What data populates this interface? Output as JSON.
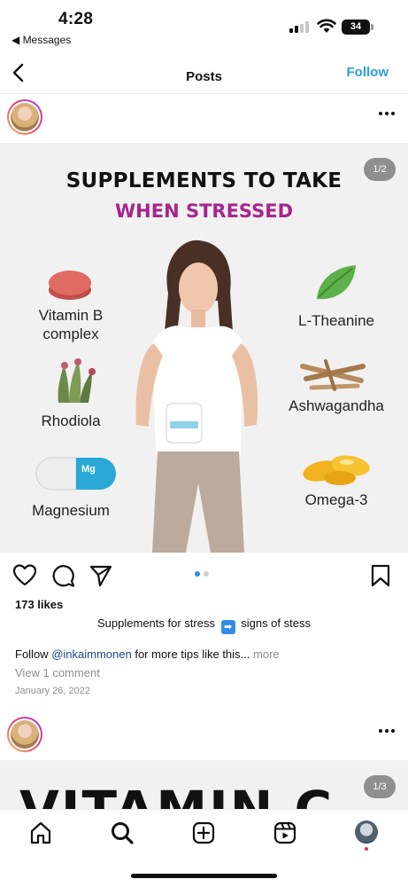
{
  "status_bar": {
    "time": "4:28",
    "back_app": "◀ Messages",
    "battery": "34"
  },
  "nav": {
    "title": "Posts",
    "follow_label": "Follow"
  },
  "post1": {
    "counter": "1/2",
    "image": {
      "title": "SUPPLEMENTS TO TAKE",
      "subtitle": "WHEN STRESSED",
      "items": [
        "Vitamin B complex",
        "Rhodiola",
        "Magnesium",
        "L-Theanine",
        "Ashwagandha",
        "Omega-3"
      ],
      "capsule_text": "Mg"
    },
    "likes": "173 likes",
    "caption_left": "Supplements for stress",
    "caption_right": "signs of stess",
    "caption_arrow": "➡",
    "follow_prefix": "Follow",
    "mention": "@inkaimmonen",
    "follow_suffix": "for more tips like this...",
    "more_label": "more",
    "view_comments": "View 1 comment",
    "date": "January 26, 2022",
    "carousel": {
      "count": 2,
      "active": 1
    }
  },
  "post2": {
    "counter": "1/3",
    "image_title": "VITAMIN C"
  },
  "tabs": [
    "home-icon",
    "search-icon",
    "add-post-icon",
    "reels-icon",
    "profile-avatar"
  ],
  "colors": {
    "accent": "#2a9ee0",
    "subtitle_magenta": "#a8248d",
    "active_dot": "#2f8fe6"
  }
}
